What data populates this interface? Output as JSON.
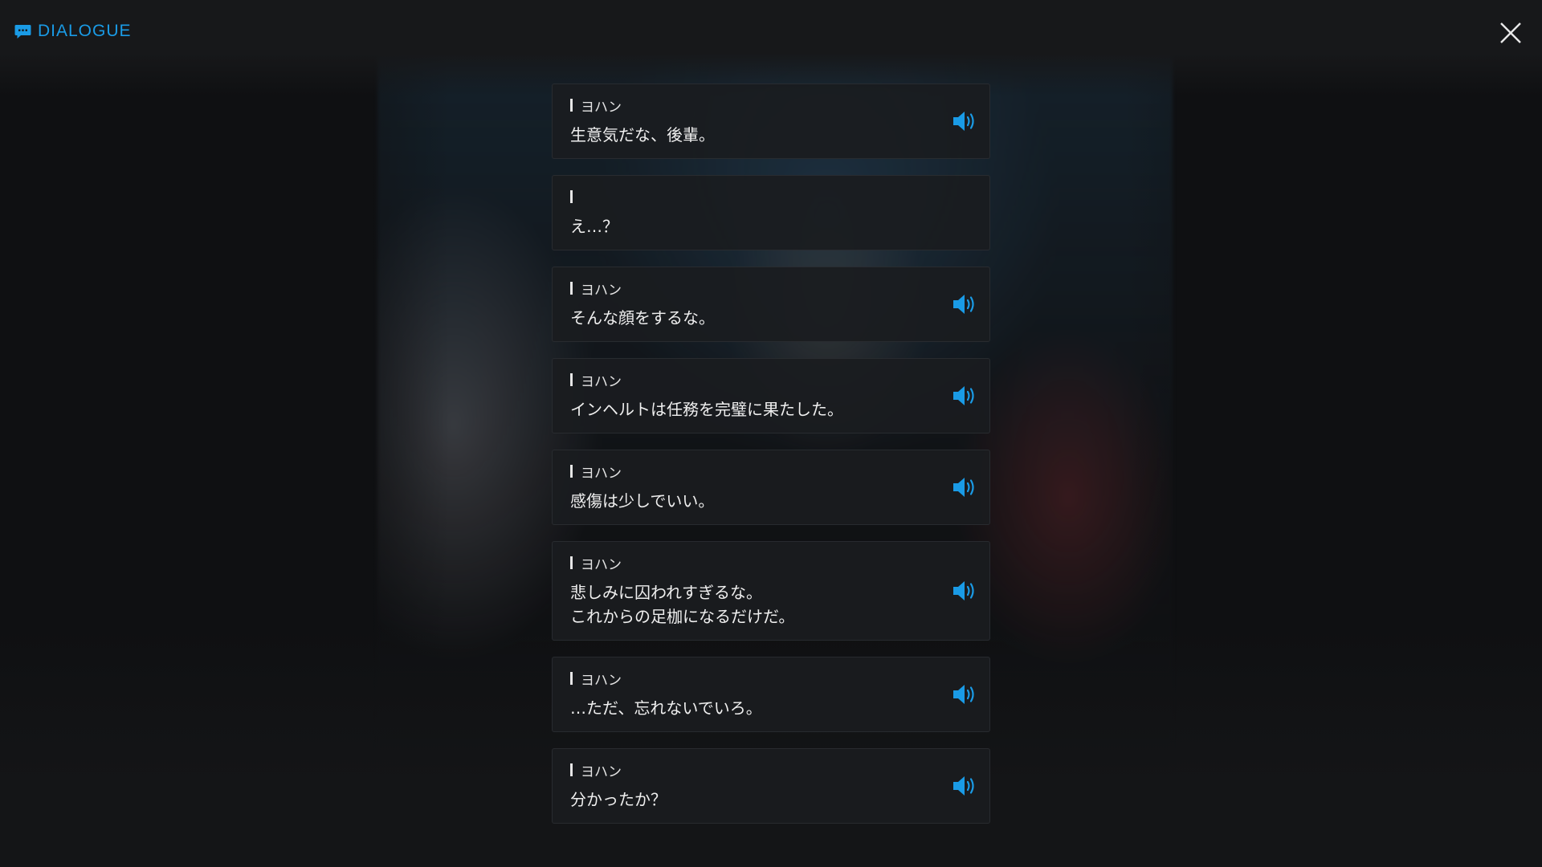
{
  "header": {
    "title": "DIALOGUE",
    "icon": "chat-bubble-icon",
    "accent_color": "#1a9be6"
  },
  "close_icon": "close-icon",
  "lines": [
    {
      "speaker": "ヨハン",
      "text": "生意気だな、後輩。",
      "voice": true
    },
    {
      "speaker": "",
      "text": "え…？",
      "voice": false
    },
    {
      "speaker": "ヨハン",
      "text": "そんな顔をするな。",
      "voice": true
    },
    {
      "speaker": "ヨハン",
      "text": "インヘルトは任務を完璧に果たした。",
      "voice": true
    },
    {
      "speaker": "ヨハン",
      "text": "感傷は少しでいい。",
      "voice": true
    },
    {
      "speaker": "ヨハン",
      "text": "悲しみに囚われすぎるな。\nこれからの足枷になるだけだ。",
      "voice": true
    },
    {
      "speaker": "ヨハン",
      "text": "…ただ、忘れないでいろ。",
      "voice": true
    },
    {
      "speaker": "ヨハン",
      "text": "分かったか？",
      "voice": true
    }
  ]
}
